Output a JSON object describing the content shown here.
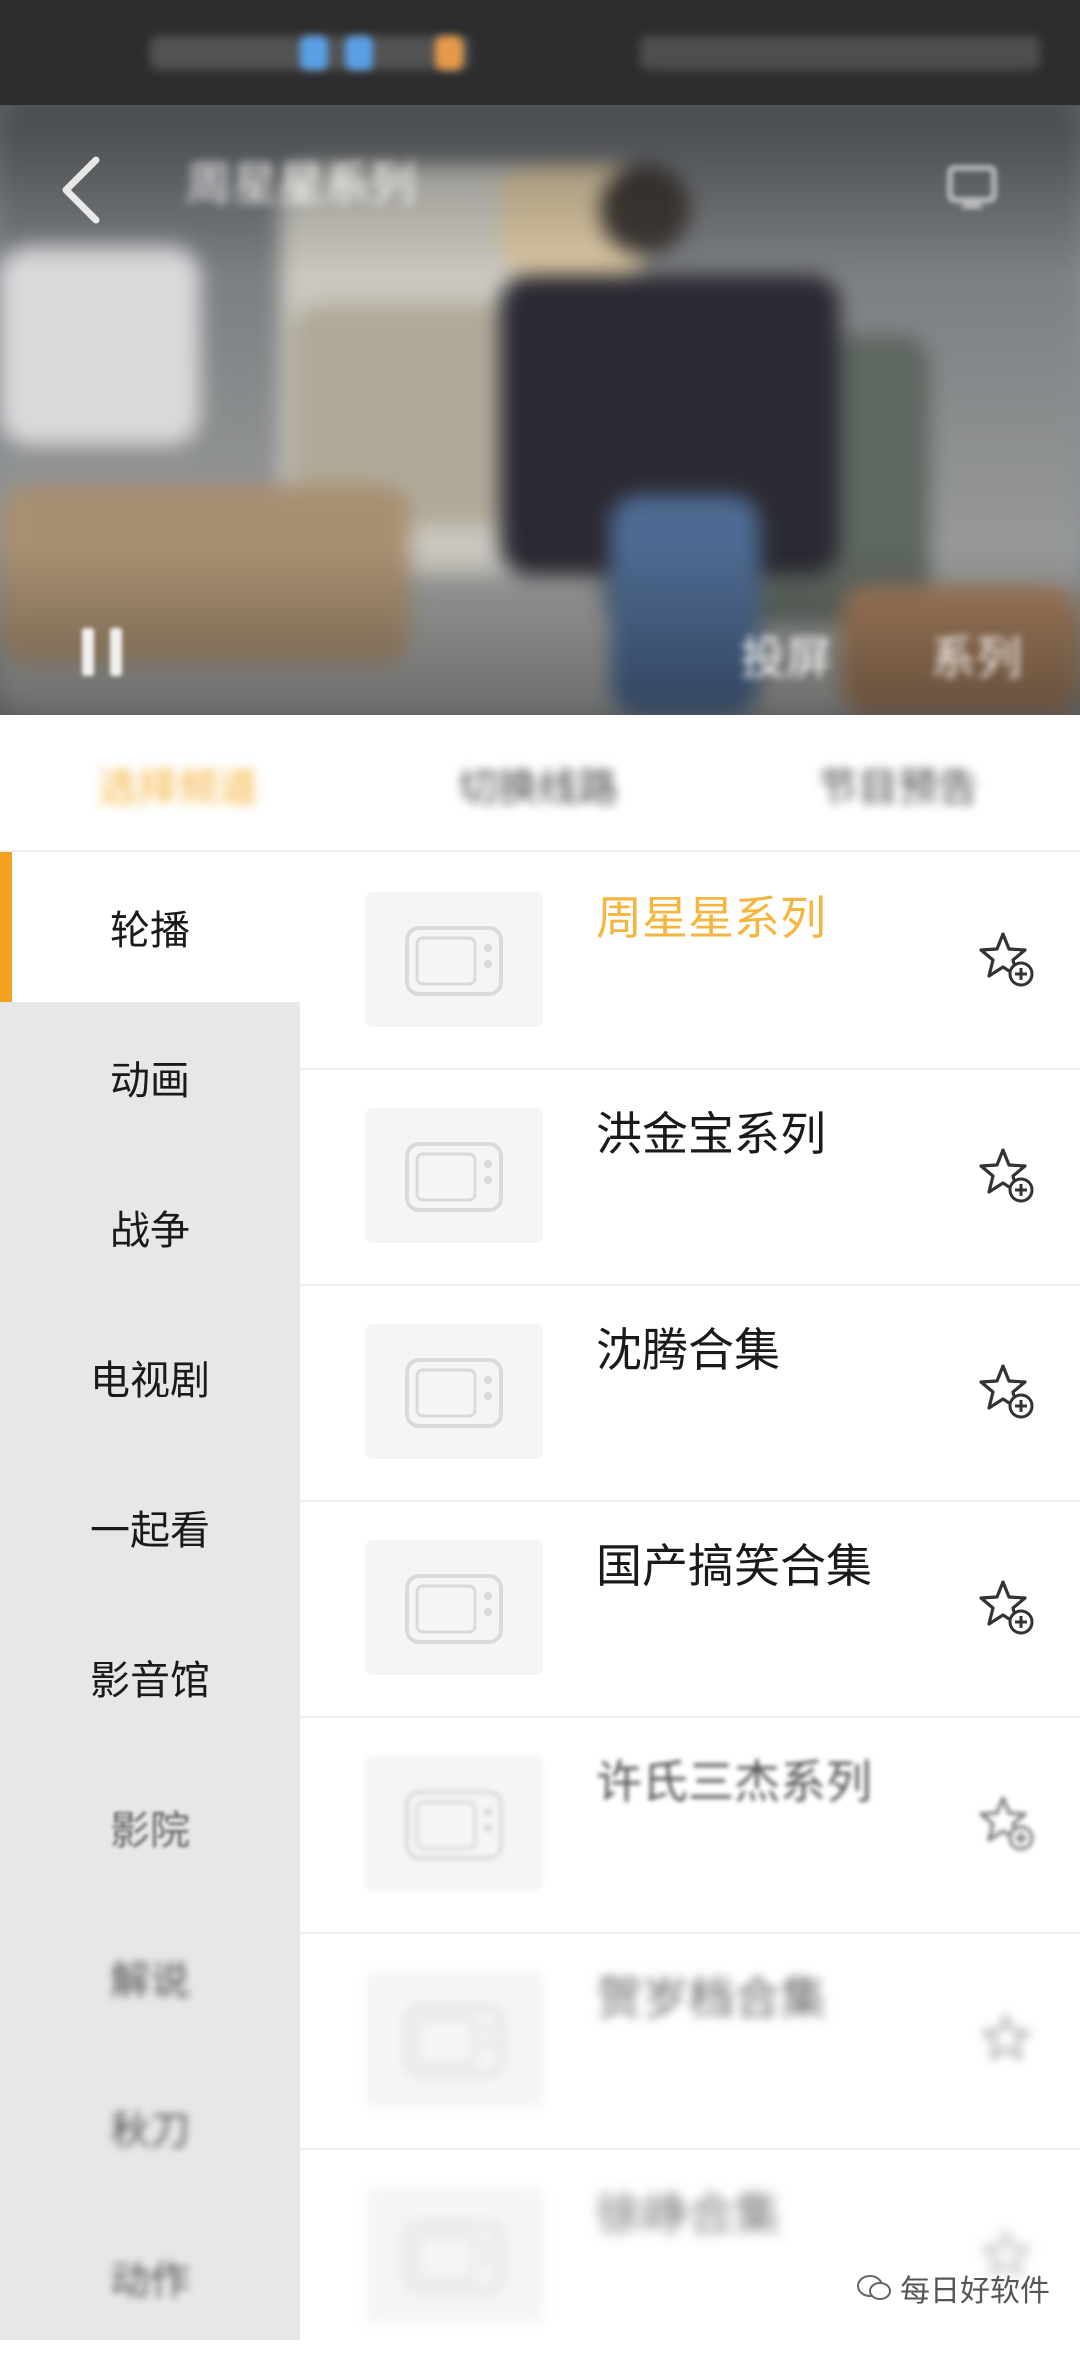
{
  "header": {
    "title": "周星星系列",
    "actions": {
      "pause": "pause",
      "cast": "cast",
      "btn1": "投屏",
      "btn2": "系列"
    }
  },
  "tabs": [
    {
      "label": "选择频道",
      "active": true
    },
    {
      "label": "切换线路",
      "active": false
    },
    {
      "label": "节目预告",
      "active": false
    }
  ],
  "sidebar": {
    "items": [
      {
        "label": "轮播",
        "active": true
      },
      {
        "label": "动画"
      },
      {
        "label": "战争"
      },
      {
        "label": "电视剧"
      },
      {
        "label": "一起看"
      },
      {
        "label": "影音馆"
      },
      {
        "label": "影院"
      },
      {
        "label": "解说"
      },
      {
        "label": "秋刀"
      },
      {
        "label": "动作"
      }
    ]
  },
  "channels": [
    {
      "title": "周星星系列",
      "highlighted": true
    },
    {
      "title": "洪金宝系列"
    },
    {
      "title": "沈腾合集"
    },
    {
      "title": "国产搞笑合集"
    },
    {
      "title": "许氏三杰系列"
    },
    {
      "title": "贺岁档合集"
    },
    {
      "title": "徐峥合集"
    }
  ],
  "watermark": "每日好软件",
  "colors": {
    "accent": "#f3a11f",
    "highlight_text": "#f4b63f",
    "sidebar_bg": "#e7e7e7"
  }
}
